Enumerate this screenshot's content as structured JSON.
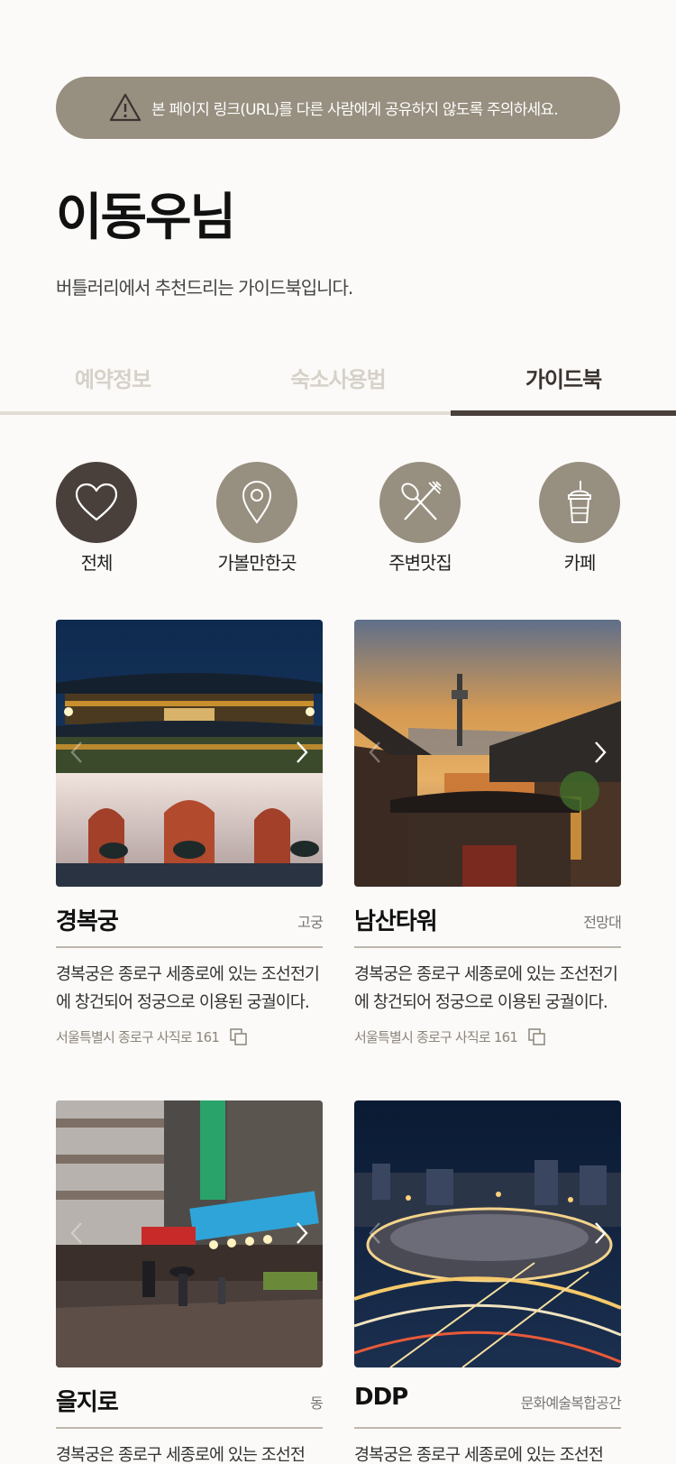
{
  "notice": {
    "text": "본 페이지 링크(URL)를 다른 사람에게 공유하지 않도록 주의하세요.",
    "icon": "warning-icon"
  },
  "header": {
    "title": "이동우님",
    "subtitle": "버틀러리에서 추천드리는 가이드북입니다."
  },
  "tabs": [
    {
      "label": "예약정보",
      "active": false
    },
    {
      "label": "숙소사용법",
      "active": false
    },
    {
      "label": "가이드북",
      "active": true
    }
  ],
  "categories": [
    {
      "label": "전체",
      "icon": "heart-icon",
      "active": true
    },
    {
      "label": "가볼만한곳",
      "icon": "map-pin-icon",
      "active": false
    },
    {
      "label": "주변맛집",
      "icon": "fork-spoon-icon",
      "active": false
    },
    {
      "label": "카페",
      "icon": "cup-icon",
      "active": false
    }
  ],
  "places": [
    {
      "name": "경복궁",
      "category": "고궁",
      "description": "경복궁은 종로구 세종로에 있는 조선전기에 창건되어 정궁으로 이용된 궁궐이다.",
      "address": "서울특별시 종로구 사직로 161"
    },
    {
      "name": "남산타워",
      "category": "전망대",
      "description": "경복궁은 종로구 세종로에 있는 조선전기에 창건되어 정궁으로 이용된 궁궐이다.",
      "address": "서울특별시 종로구 사직로 161"
    },
    {
      "name": "을지로",
      "category": "동",
      "description": "경복궁은 종로구 세종로에 있는 조선전",
      "address": ""
    },
    {
      "name": "DDP",
      "category": "문화예술복합공간",
      "description": "경복궁은 종로구 세종로에 있는 조선전",
      "address": ""
    }
  ],
  "colors": {
    "accent": "#4a403b",
    "muted": "#978f7f",
    "background": "#fbfaf8"
  }
}
